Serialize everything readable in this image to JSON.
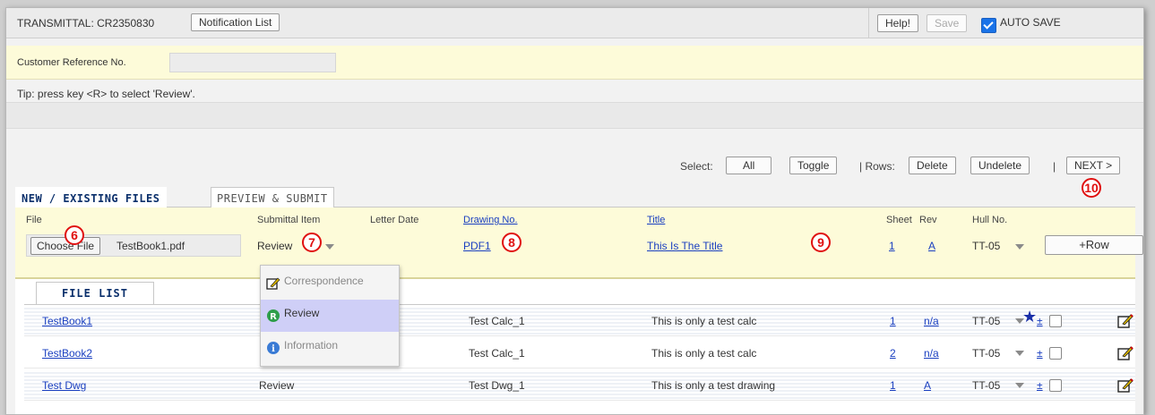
{
  "header": {
    "transmittal_label": "TRANSMITTAL: CR2350830",
    "notification_list": "Notification List",
    "help": "Help!",
    "save": "Save",
    "auto_save": "AUTO SAVE",
    "auto_save_checked": true
  },
  "customer_ref": {
    "label": "Customer Reference No.",
    "value": ""
  },
  "tip": "Tip: press key <R> to select 'Review'.",
  "select_bar": {
    "select_label": "Select:",
    "all": "All",
    "toggle": "Toggle",
    "rows_label": "| Rows:",
    "delete": "Delete",
    "undelete": "Undelete",
    "sep": "|",
    "next": "NEXT >"
  },
  "tabs": [
    {
      "label": "NEW / EXISTING FILES",
      "active": true
    },
    {
      "label": "PREVIEW & SUBMIT",
      "active": false
    }
  ],
  "columns": {
    "file": "File",
    "submittal_item": "Submittal Item",
    "letter_date": "Letter Date",
    "drawing_no": "Drawing No.",
    "title": "Title",
    "sheet": "Sheet",
    "rev": "Rev",
    "hull_no": "Hull No."
  },
  "new_row": {
    "choose_file": "Choose File",
    "file_name": "TestBook1.pdf",
    "submittal_item": "Review",
    "drawing_no": "PDF1",
    "title": "This Is The Title",
    "sheet": "1",
    "rev": "A",
    "hull_no": "TT-05",
    "add_row": "+Row"
  },
  "file_list_tab": "FILE LIST",
  "files": [
    {
      "name": "TestBook1",
      "submittal": "",
      "drawing": "Test Calc_1",
      "title": "This is only a test calc",
      "sheet": "1",
      "rev": "n/a",
      "hull": "TT-05",
      "plus": "±"
    },
    {
      "name": "TestBook2",
      "submittal": "",
      "drawing": "Test Calc_1",
      "title": "This is only a test calc",
      "sheet": "2",
      "rev": "n/a",
      "hull": "TT-05",
      "plus": "±"
    },
    {
      "name": "Test Dwg",
      "submittal": "Review",
      "drawing": "Test Dwg_1",
      "title": "This is only a test drawing",
      "sheet": "1",
      "rev": "A",
      "hull": "TT-05",
      "plus": "±"
    }
  ],
  "dropdown": {
    "items": [
      {
        "label": "Correspondence",
        "icon": "correspondence-icon",
        "selected": false
      },
      {
        "label": "Review",
        "icon": "review-icon",
        "selected": true
      },
      {
        "label": "Information",
        "icon": "information-icon",
        "selected": false
      }
    ]
  },
  "callouts": [
    "6",
    "7",
    "8",
    "9",
    "10"
  ],
  "colors": {
    "accent": "#1a73e8",
    "link": "#1a3fc0",
    "callout": "#e01010",
    "highlight": "#fdfbd9"
  }
}
